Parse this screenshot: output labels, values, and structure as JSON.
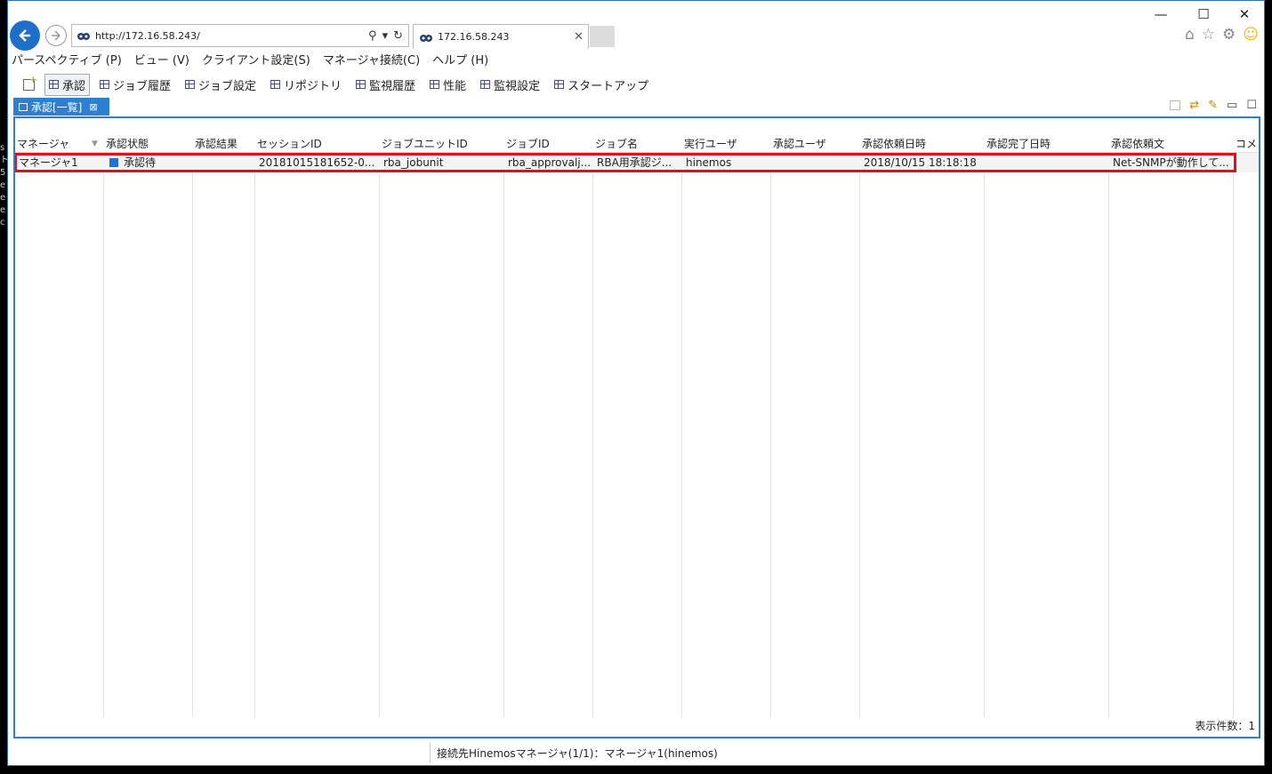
{
  "browser": {
    "url": "http://172.16.58.243/",
    "tab_title": "172.16.58.243"
  },
  "menu": [
    "パースペクティブ (P)",
    "ビュー (V)",
    "クライアント設定(S)",
    "マネージャ接続(C)",
    "ヘルプ (H)"
  ],
  "perspectives": [
    {
      "label": "承認",
      "active": true
    },
    {
      "label": "ジョブ履歴",
      "active": false
    },
    {
      "label": "ジョブ設定",
      "active": false
    },
    {
      "label": "リポジトリ",
      "active": false
    },
    {
      "label": "監視履歴",
      "active": false
    },
    {
      "label": "性能",
      "active": false
    },
    {
      "label": "監視設定",
      "active": false
    },
    {
      "label": "スタートアップ",
      "active": false
    }
  ],
  "view": {
    "tab_label": "承認[一覧]",
    "columns": [
      "マネージャ",
      "承認状態",
      "承認結果",
      "セッションID",
      "ジョブユニットID",
      "ジョブID",
      "ジョブ名",
      "実行ユーザ",
      "承認ユーザ",
      "承認依頼日時",
      "承認完了日時",
      "承認依頼文",
      "コメ"
    ],
    "rows": [
      {
        "manager": "マネージャ1",
        "status": "承認待",
        "result": "",
        "session_id": "20181015181652-0...",
        "jobunit_id": "rba_jobunit",
        "job_id": "rba_approvalj...",
        "job_name": "RBA用承認ジ...",
        "exec_user": "hinemos",
        "approve_user": "",
        "request_date": "2018/10/15 18:18:18",
        "complete_date": "",
        "request_text": "Net-SNMPが動作して..."
      }
    ],
    "count_label": "表示件数：1"
  },
  "statusbar": {
    "text": "接続先Hinemosマネージャ(1/1)：マネージャ1(hinemos)"
  },
  "colors": {
    "accent": "#2c7fd1",
    "highlight": "#e0101a",
    "status_pending": "#1f73d8"
  }
}
